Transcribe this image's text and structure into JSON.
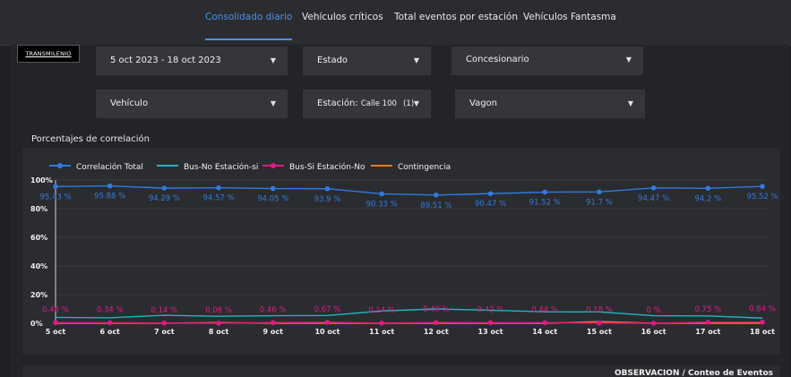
{
  "nav": {
    "tabs": [
      {
        "label": "Consolidado diario",
        "active": true
      },
      {
        "label": "Vehículos críticos",
        "active": false
      },
      {
        "label": "Total eventos por estación",
        "active": false
      },
      {
        "label": "Vehículos Fantasma",
        "active": false
      }
    ]
  },
  "logo": {
    "text": "TRANSMILENIO"
  },
  "filters": {
    "date_range": "5 oct 2023 - 18 oct 2023",
    "estado": "Estado",
    "concesionario": "Concesionario",
    "vehiculo": "Vehículo",
    "estacion_label": "Estación:",
    "estacion_value": "Calle 100",
    "estacion_count": "(1)",
    "vagon": "Vagon"
  },
  "section": {
    "title": "Porcentajes de correlación"
  },
  "bottom": {
    "label": "OBSERVACION / Conteo de Eventos"
  },
  "colors": {
    "accent": "#4a90e8",
    "correlacion_total": "#2f7be3",
    "bus_no_estacion_si": "#1fb5c4",
    "bus_si_estacion_no": "#e3178a",
    "contingencia": "#f07b1a"
  },
  "chart_data": {
    "type": "line",
    "x": [
      "5 oct",
      "6 oct",
      "7 oct",
      "8 oct",
      "9 oct",
      "10 oct",
      "11 oct",
      "12 oct",
      "13 oct",
      "14 oct",
      "15 oct",
      "16 oct",
      "17 oct",
      "18 oct"
    ],
    "y_ticks": [
      "100%",
      "80%",
      "60%",
      "40%",
      "20%",
      "0%"
    ],
    "ylim": [
      0,
      100
    ],
    "legend_position": "top-left",
    "series": [
      {
        "name": "Correlación Total",
        "color": "#2f7be3",
        "values": [
          95.43,
          95.88,
          94.29,
          94.57,
          94.05,
          93.9,
          90.33,
          89.51,
          90.47,
          91.52,
          91.7,
          94.47,
          94.2,
          95.52
        ],
        "labels": [
          "95.43 %",
          "95.88 %",
          "94.29 %",
          "94.57 %",
          "94.05 %",
          "93.9 %",
          "90.33 %",
          "89.51 %",
          "90.47 %",
          "91.52 %",
          "91.7 %",
          "94.47 %",
          "94.2 %",
          "95.52 %"
        ]
      },
      {
        "name": "Bus-No Estación-si",
        "color": "#1fb5c4",
        "values": [
          4.1,
          3.8,
          5.6,
          4.9,
          5.3,
          5.4,
          8.6,
          10.0,
          9.1,
          8.0,
          7.9,
          5.3,
          5.1,
          3.6
        ]
      },
      {
        "name": "Bus-Si Estación-No",
        "color": "#e3178a",
        "values": [
          0.46,
          0.34,
          0.14,
          0.06,
          0.46,
          0.67,
          0.14,
          0.49,
          0.42,
          0.44,
          0.18,
          0,
          0.75,
          0.84
        ],
        "labels": [
          "0.46 %",
          "0.34 %",
          "0.14 %",
          "0.06 %",
          "0.46 %",
          "0.67 %",
          "0.14 %",
          "0.49 %",
          "0.42 %",
          "0.44 %",
          "0.18 %",
          "0 %",
          "0.75 %",
          "0.84 %"
        ]
      },
      {
        "name": "Contingencia",
        "color": "#f07b1a",
        "values": [
          0,
          0,
          0,
          0.5,
          0,
          0,
          0,
          0,
          0,
          0,
          1.2,
          0,
          0,
          0
        ]
      }
    ]
  }
}
